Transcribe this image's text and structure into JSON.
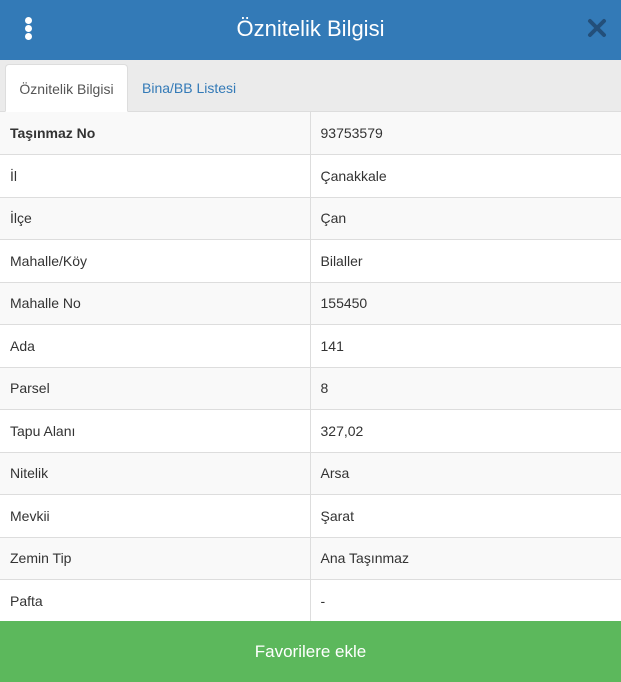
{
  "header": {
    "title": "Öznitelik Bilgisi",
    "menu_icon": "vertical-ellipsis-icon",
    "close_icon": "close-icon",
    "color": "#337ab7"
  },
  "tabs": [
    {
      "label": "Öznitelik Bilgisi",
      "active": true
    },
    {
      "label": "Bina/BB Listesi",
      "active": false
    }
  ],
  "attributes": [
    {
      "key": "Taşınmaz No",
      "value": "93753579"
    },
    {
      "key": "İl",
      "value": "Çanakkale"
    },
    {
      "key": "İlçe",
      "value": "Çan"
    },
    {
      "key": "Mahalle/Köy",
      "value": "Bilaller"
    },
    {
      "key": "Mahalle No",
      "value": "155450"
    },
    {
      "key": "Ada",
      "value": "141"
    },
    {
      "key": "Parsel",
      "value": "8"
    },
    {
      "key": "Tapu Alanı",
      "value": "327,02"
    },
    {
      "key": "Nitelik",
      "value": "Arsa"
    },
    {
      "key": "Mevkii",
      "value": "Şarat"
    },
    {
      "key": "Zemin Tip",
      "value": "Ana Taşınmaz"
    },
    {
      "key": "Pafta",
      "value": "-"
    }
  ],
  "footer": {
    "button_label": "Favorilere ekle",
    "button_color": "#5cb85c"
  }
}
